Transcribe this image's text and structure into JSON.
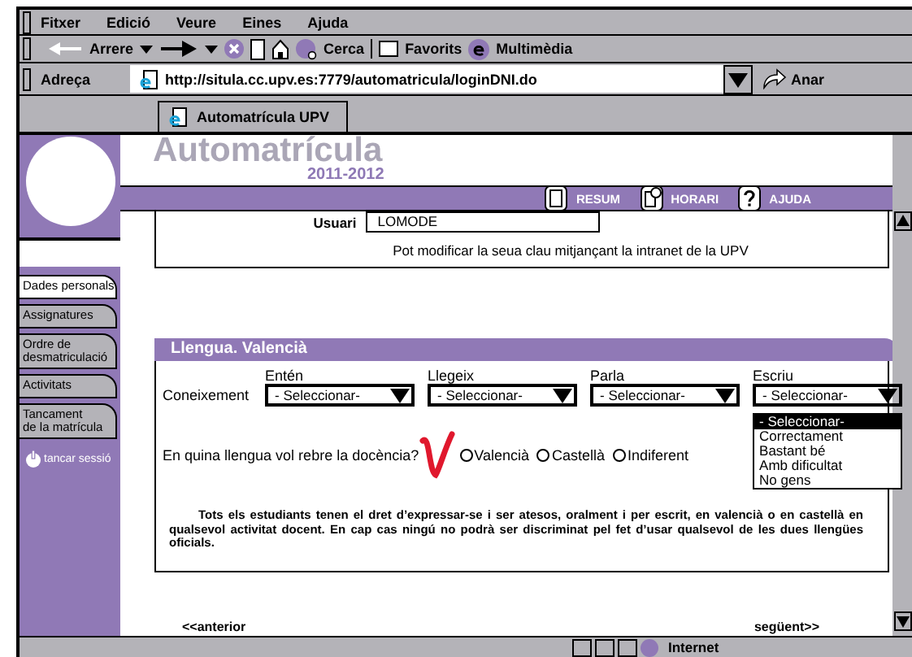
{
  "menu": [
    "Fitxer",
    "Edició",
    "Veure",
    "Eines",
    "Ajuda"
  ],
  "toolbar": {
    "back": "Arrere",
    "search": "Cerca",
    "favorites": "Favorits",
    "media": "Multimèdia"
  },
  "address": {
    "label": "Adreça",
    "url": "http://situla.cc.upv.es:7779/automatricula/loginDNI.do",
    "go": "Anar"
  },
  "tabs": [
    {
      "label": "Automatrícula UPV",
      "selected": true
    }
  ],
  "header": {
    "title": "Automatrícula",
    "year": "2011-2012",
    "links": [
      {
        "label": "RESUM",
        "kind": "page"
      },
      {
        "label": "HORARI",
        "kind": "clock"
      },
      {
        "label": "AJUDA",
        "kind": "help"
      }
    ]
  },
  "user": {
    "label": "Usuari",
    "value": "LOMODE",
    "note": "Pot modificar la seua clau mitjançant la intranet de la UPV"
  },
  "sidebar": {
    "items": [
      {
        "label": "Dades personals",
        "selected": true
      },
      {
        "label": "Assignatures",
        "selected": false
      },
      {
        "label": "Ordre de\ndesmatriculació",
        "selected": false
      },
      {
        "label": "Activitats",
        "selected": false
      },
      {
        "label": "Tancament\nde la matrícula",
        "selected": false
      }
    ],
    "logout": "tancar sessió"
  },
  "section": {
    "title": "Llengua. Valencià",
    "knowledge_label": "Coneixement",
    "selects": [
      {
        "label": "Entén",
        "value": "- Seleccionar-"
      },
      {
        "label": "Llegeix",
        "value": "- Seleccionar-"
      },
      {
        "label": "Parla",
        "value": "- Seleccionar-"
      },
      {
        "label": "Escriu",
        "value": "- Seleccionar-",
        "options": [
          {
            "label": "- Seleccionar-",
            "selected": true
          },
          {
            "label": "Correctament",
            "selected": false
          },
          {
            "label": "Bastant bé",
            "selected": false
          },
          {
            "label": "Amb dificultat",
            "selected": false
          },
          {
            "label": "No gens",
            "selected": false
          }
        ]
      }
    ],
    "question": "En quina llengua vol rebre la docència?",
    "options": [
      {
        "label": "Valencià",
        "selected": false
      },
      {
        "label": "Castellà",
        "selected": false
      },
      {
        "label": "Indiferent",
        "selected": false
      }
    ],
    "notice": "Tots els estudiants tenen el dret d’expressar-se i ser atesos, oralment i per escrit, en valencià o en castellà en qualsevol activitat docent. En cap cas ningú no podrà ser discriminat pel fet d’usar qualsevol de les dues llengües oficials."
  },
  "nav": {
    "previous": "<<anterior",
    "next": "següent>>"
  },
  "status_bar": {
    "zone": "Internet"
  }
}
